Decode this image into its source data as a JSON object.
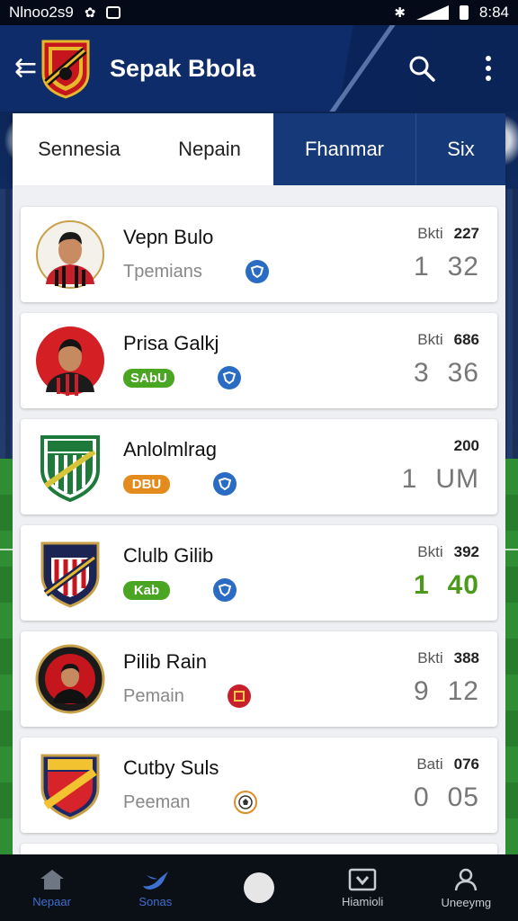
{
  "status_bar": {
    "carrier": "Nlnoo2s9",
    "time": "8:84"
  },
  "header": {
    "title": "Sepak Bbola",
    "back_icon": "back-arrow-icon",
    "search_icon": "search-icon",
    "menu_icon": "more-vert-icon"
  },
  "tabs": [
    {
      "label": "Sennesia",
      "active": false
    },
    {
      "label": "Nepain",
      "active": false
    },
    {
      "label": "Fhanmar",
      "active": true
    },
    {
      "label": "Six",
      "active": true
    }
  ],
  "items": [
    {
      "name": "Vepn Bulo",
      "subtext": "Tpemians",
      "pill": "",
      "pill_color": "",
      "stat_label": "Bkti",
      "stat_value": "227",
      "score_a": "1",
      "score_b": "32",
      "score_style": "grey",
      "avatar": "player-photo",
      "tag_icon": "shield-badge-icon",
      "tag_color": "#2a6bc4"
    },
    {
      "name": "Prisa Galkj",
      "subtext": "",
      "pill": "SAbU",
      "pill_color": "#4aa522",
      "stat_label": "Bkti",
      "stat_value": "686",
      "score_a": "3",
      "score_b": "36",
      "score_style": "grey",
      "avatar": "player-photo",
      "tag_icon": "shield-badge-icon",
      "tag_color": "#2a6bc4"
    },
    {
      "name": "Anlolmlrag",
      "subtext": "",
      "pill": "DBU",
      "pill_color": "#e38b1c",
      "stat_label": "",
      "stat_value": "200",
      "score_a": "1",
      "score_b": "UM",
      "score_style": "grey",
      "avatar": "club-crest-green",
      "tag_icon": "shield-badge-icon",
      "tag_color": "#2a6bc4"
    },
    {
      "name": "Clulb Gilib",
      "subtext": "",
      "pill": "Kab",
      "pill_color": "#4aa522",
      "stat_label": "Bkti",
      "stat_value": "392",
      "score_a": "1",
      "score_b": "40",
      "score_style": "green",
      "avatar": "club-crest-navy",
      "tag_icon": "shield-badge-icon",
      "tag_color": "#2a6bc4"
    },
    {
      "name": "Pilib Rain",
      "subtext": "Pemain",
      "pill": "",
      "pill_color": "",
      "stat_label": "Bkti",
      "stat_value": "388",
      "score_a": "9",
      "score_b": "12",
      "score_style": "grey",
      "avatar": "player-medallion",
      "tag_icon": "club-badge-icon",
      "tag_color": "#c8202a"
    },
    {
      "name": "Cutby Suls",
      "subtext": "Peeman",
      "pill": "",
      "pill_color": "",
      "stat_label": "Bati",
      "stat_value": "076",
      "score_a": "0",
      "score_b": "05",
      "score_style": "grey",
      "avatar": "club-crest-red",
      "tag_icon": "ball-icon",
      "tag_color": "#d9902a"
    }
  ],
  "bottom_nav": [
    {
      "label": "Nepaar",
      "icon": "home-icon",
      "active": true
    },
    {
      "label": "Sonas",
      "icon": "bird-icon",
      "active": true
    },
    {
      "label": "",
      "icon": "home-button",
      "active": false
    },
    {
      "label": "Hiamioli",
      "icon": "heart-box-icon",
      "active": false
    },
    {
      "label": "Uneeymg",
      "icon": "profile-icon",
      "active": false
    }
  ]
}
